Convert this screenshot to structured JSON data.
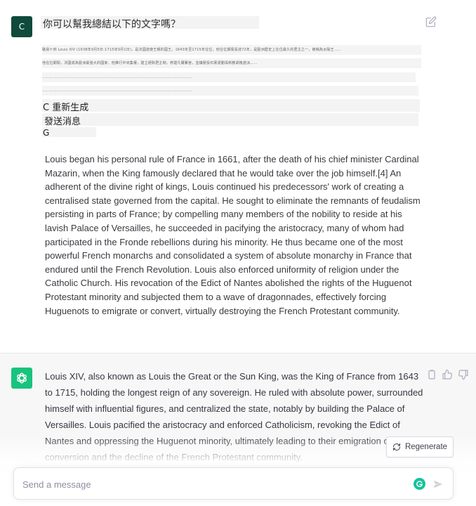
{
  "user_message": {
    "avatar_letter": "C",
    "prompt": "你可以幫我總結以下的文字嗎？",
    "blurred_lines": [
      "路易十四 Louis XIV (1638年9月5日-1715年9月1日)，是法國波旁王朝的國王，1643年至1715年在位，他在位期間長達72年，是歐洲歷史上在位最久的君主之一，被稱為太陽王……",
      "他在位期間，法國成為歐洲最強大的國家，他推行中央集權，建立絕對君主制，修建凡爾賽宮，並鎮壓投石黨運動與新教胡格諾派……",
      "……………………………………………………………………………………………………………",
      "……………………………………………………………………………………………………………"
    ],
    "cn_lines": [
      "C 重新生成",
      "發送消息",
      "G"
    ],
    "source_text": "Louis began his personal rule of France in 1661, after the death of his chief minister Cardinal Mazarin, when the King famously declared that he would take over the job himself.[4] An adherent of the divine right of kings, Louis continued his predecessors' work of creating a centralised state governed from the capital. He sought to eliminate the remnants of feudalism persisting in parts of France; by compelling many members of the nobility to reside at his lavish Palace of Versailles, he succeeded in pacifying the aristocracy, many of whom had participated in the Fronde rebellions during his minority. He thus became one of the most powerful French monarchs and consolidated a system of absolute monarchy in France that endured until the French Revolution. Louis also enforced uniformity of religion under the Catholic Church. His revocation of the Edict of Nantes abolished the rights of the Huguenot Protestant minority and subjected them to a wave of dragonnades, effectively forcing Huguenots to emigrate or convert, virtually destroying the French Protestant community."
  },
  "assistant_message": {
    "text": "Louis XIV, also known as Louis the Great or the Sun King, was the King of France from 1643 to 1715, holding the longest reign of any sovereign. He ruled with absolute power, surrounded himself with influential figures, and centralized the state, notably by building the Palace of Versailles. Louis pacified the aristocracy and enforced Catholicism, revoking the Edict of Nantes and oppressing the Huguenot minority, ultimately leading to their emigration or conversion and the decline of the French Protestant community."
  },
  "regenerate": {
    "label": "Regenerate"
  },
  "composer": {
    "placeholder": "Send a message"
  },
  "icons": {
    "edit": "edit-icon",
    "copy": "copy-icon",
    "thumbs_up": "thumbs-up-icon",
    "thumbs_down": "thumbs-down-icon",
    "regenerate": "refresh-icon",
    "send": "send-icon",
    "grammarly": "grammarly-icon"
  },
  "colors": {
    "user_avatar_bg": "#0f4a3d",
    "assistant_avatar_bg": "#19c37d",
    "assistant_block_bg": "#f7f7f8",
    "grammarly_green": "#15c39a"
  }
}
